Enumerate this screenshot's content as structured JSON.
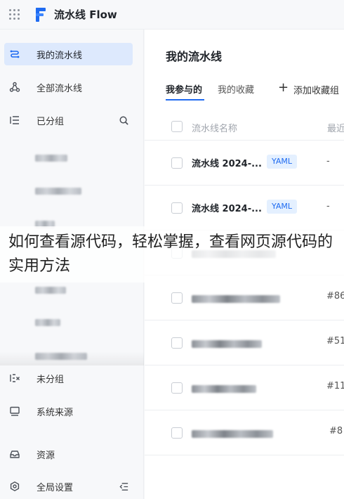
{
  "app": {
    "title": "流水线 Flow"
  },
  "sidebar": {
    "items": [
      {
        "label": "我的流水线",
        "icon": "pipeline-icon",
        "active": true
      },
      {
        "label": "全部流水线",
        "icon": "nodes-icon"
      },
      {
        "label": "已分组",
        "icon": "list-icon",
        "right_icon": "search-icon"
      },
      {
        "label": "未分组",
        "icon": "ungrouped-icon"
      },
      {
        "label": "系统来源",
        "icon": "monitor-icon"
      },
      {
        "label": "资源",
        "icon": "inbox-icon"
      },
      {
        "label": "全局设置",
        "icon": "settings-icon",
        "right_icon": "collapse-icon"
      }
    ]
  },
  "main": {
    "title": "我的流水线",
    "tabs": [
      {
        "label": "我参与的",
        "active": true
      },
      {
        "label": "我的收藏"
      }
    ],
    "add_label": "添加收藏组",
    "columns": {
      "name": "流水线名称",
      "last": "最近"
    },
    "rows": [
      {
        "name": "流水线 2024-...",
        "tag": "YAML",
        "last": "-"
      },
      {
        "name": "流水线 2024-...",
        "tag": "YAML",
        "last": "-"
      },
      {
        "name": "",
        "tag": "",
        "last": ""
      },
      {
        "name": "",
        "tag": "",
        "last": "#86"
      },
      {
        "name": "",
        "tag": "",
        "last": "#51"
      },
      {
        "name": "",
        "tag": "",
        "last": "#11"
      },
      {
        "name": "",
        "tag": "",
        "last": "#8"
      }
    ]
  },
  "overlay": {
    "caption": "如何查看源代码，轻松掌握，查看网页源代码的实用方法"
  }
}
